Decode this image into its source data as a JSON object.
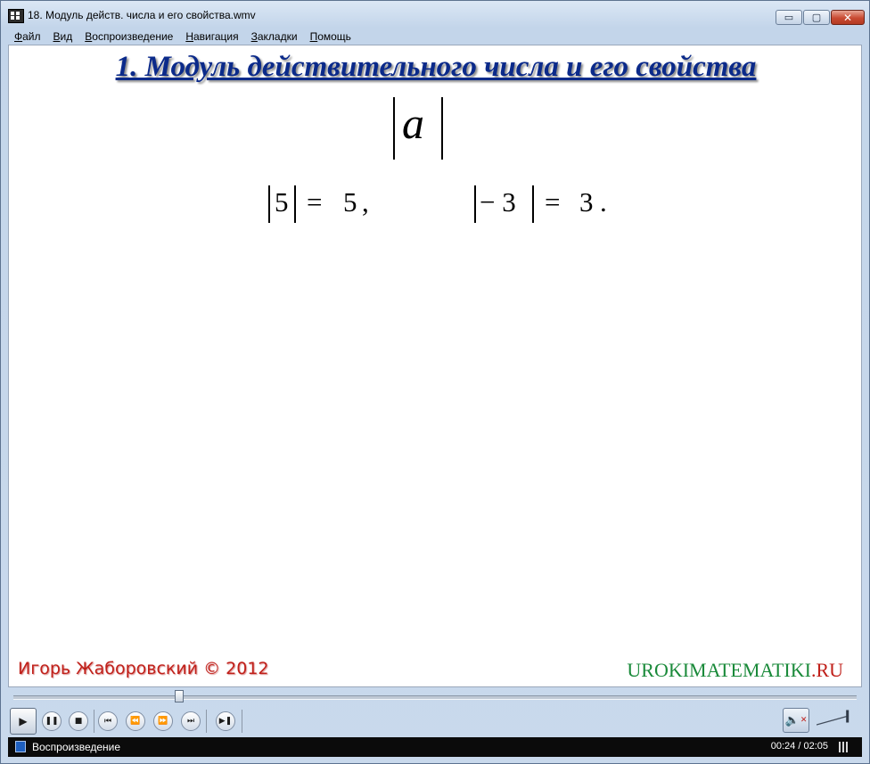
{
  "window": {
    "title": "18. Модуль действ. числа и его свойства.wmv",
    "minimize_label": "▭",
    "maximize_label": "▢",
    "close_label": "✕"
  },
  "menu": {
    "items": [
      {
        "key": "Ф",
        "rest": "айл"
      },
      {
        "key": "В",
        "rest": "ид"
      },
      {
        "key": "В",
        "rest": "оспроизведение"
      },
      {
        "key": "Н",
        "rest": "авигация"
      },
      {
        "key": "З",
        "rest": "акладки"
      },
      {
        "key": "П",
        "rest": "омощь"
      }
    ]
  },
  "slide": {
    "title": "1. Модуль действительного числа и его свойства",
    "symbol": "a",
    "example1": {
      "inside": "5",
      "equals": "=",
      "result": "5",
      "punct": ","
    },
    "example2": {
      "inside": "− 3",
      "equals": "=",
      "result": "3",
      "punct": "."
    },
    "author": "Игорь Жаборовский © 2012",
    "site_green": "UROKIMATEMATIKI",
    "site_red": ".RU"
  },
  "playback": {
    "position_fraction": 0.193,
    "status": "Воспроизведение",
    "time": "00:24 / 02:05",
    "volume_fraction": 0.95
  },
  "colors": {
    "title": "#0b2a8a",
    "author": "#c0201a",
    "site_green": "#1a8a3a",
    "site_red": "#c0201a"
  },
  "icons": {
    "play": "play-icon",
    "pause": "pause-icon",
    "stop": "stop-icon",
    "previous": "previous-icon",
    "rewind": "rewind-icon",
    "fast_forward": "fast-forward-icon",
    "next": "next-icon",
    "frame_step": "frame-step-icon",
    "mute": "mute-icon"
  }
}
